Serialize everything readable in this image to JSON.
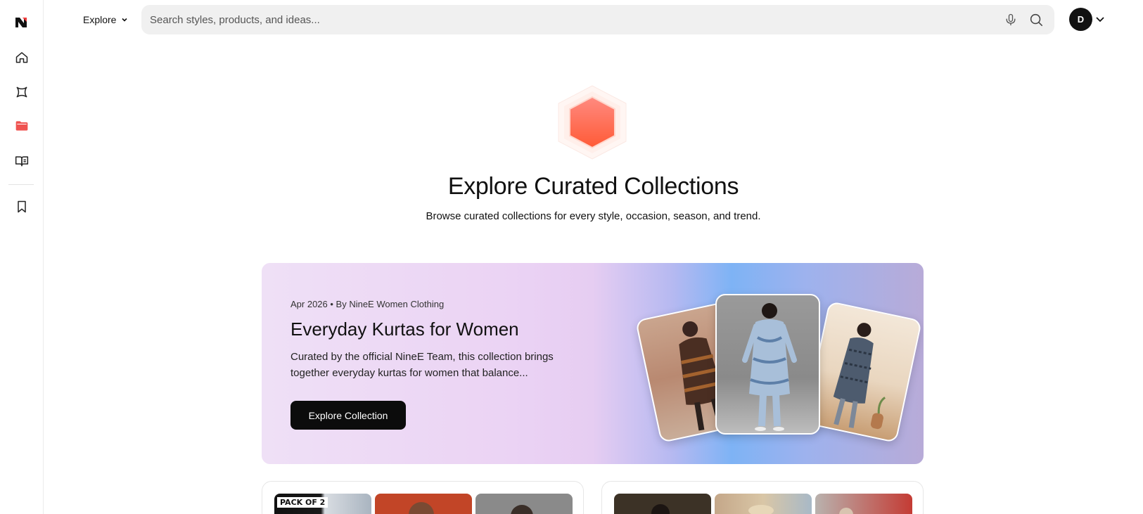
{
  "nav": {
    "items": [
      {
        "icon": "home-icon"
      },
      {
        "icon": "sparkle-icon"
      },
      {
        "icon": "folder-icon",
        "active": true
      },
      {
        "icon": "book-icon"
      },
      {
        "icon": "bookmark-icon"
      }
    ],
    "active_color": "#ef5350"
  },
  "topbar": {
    "explore_label": "Explore",
    "search_placeholder": "Search styles, products, and ideas...",
    "avatar_initial": "D"
  },
  "hero": {
    "title": "Explore Curated Collections",
    "subtitle": "Browse curated collections for every style, occasion, season, and trend.",
    "hex_color": "#ff6b4f"
  },
  "featured": {
    "meta": "Apr 2026 • By NineE Women Clothing",
    "title": "Everyday Kurtas for Women",
    "description": "Curated by the official NineE Team, this collection brings together everyday kurtas for women that balance...",
    "button_label": "Explore Collection"
  },
  "collections": [
    {
      "pack_label": "PACK OF 2"
    },
    {}
  ]
}
